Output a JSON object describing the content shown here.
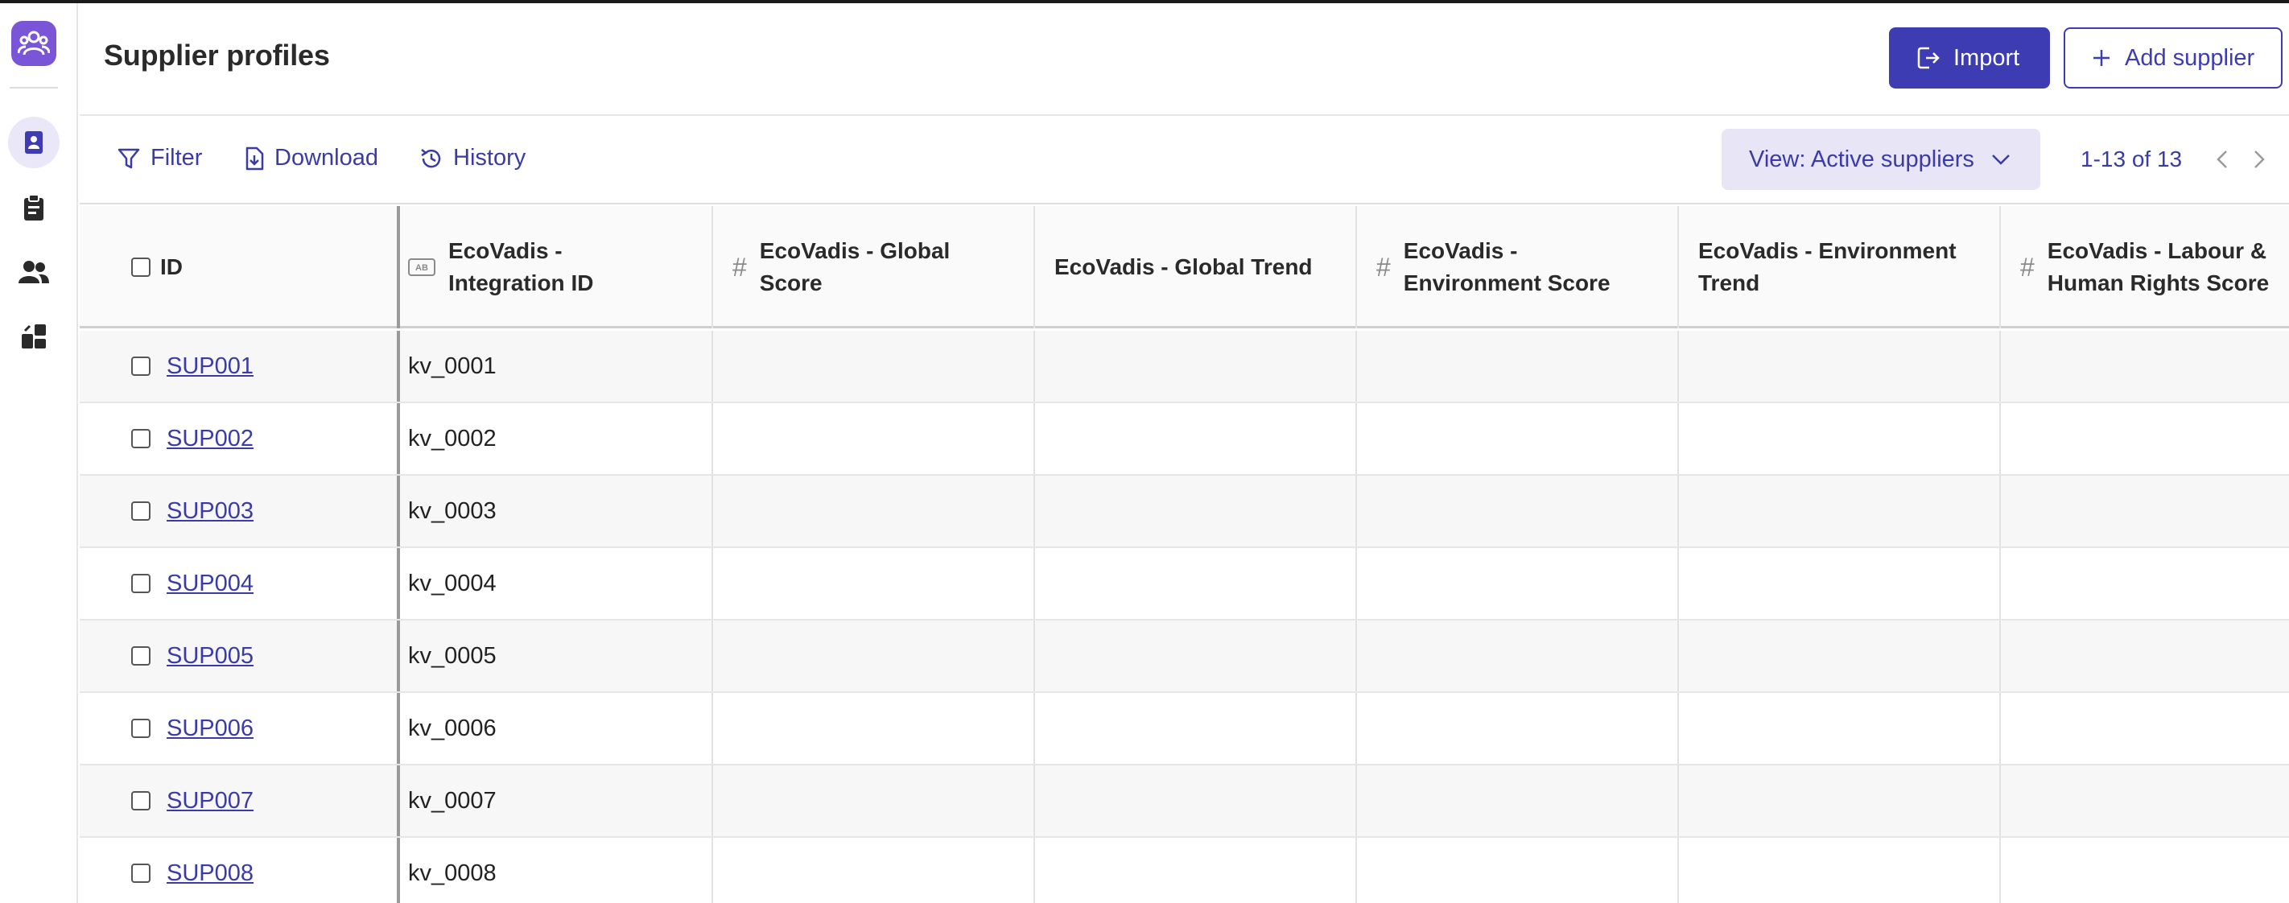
{
  "sidebar": {
    "logo": "team-logo-icon",
    "items": [
      {
        "name": "profiles-icon",
        "active": true
      },
      {
        "name": "clipboard-icon",
        "active": false
      },
      {
        "name": "users-icon",
        "active": false
      },
      {
        "name": "integrations-icon",
        "active": false
      }
    ]
  },
  "header": {
    "title": "Supplier profiles",
    "import_label": "Import",
    "add_label": "Add supplier"
  },
  "toolbar": {
    "filter_label": "Filter",
    "download_label": "Download",
    "history_label": "History",
    "view_label": "View: Active suppliers",
    "pagination": "1-13 of 13"
  },
  "table": {
    "columns": [
      {
        "type_icon": "",
        "label_1": "ID",
        "label_2": ""
      },
      {
        "type_icon": "AB",
        "label_1": "EcoVadis -",
        "label_2": "Integration ID"
      },
      {
        "type_icon": "#",
        "label_1": "EcoVadis - Global",
        "label_2": "Score"
      },
      {
        "type_icon": "",
        "label_1": "EcoVadis - Global Trend",
        "label_2": ""
      },
      {
        "type_icon": "#",
        "label_1": "EcoVadis -",
        "label_2": "Environment Score"
      },
      {
        "type_icon": "",
        "label_1": "EcoVadis - Environment",
        "label_2": "Trend"
      },
      {
        "type_icon": "#",
        "label_1": "EcoVadis - Labour &",
        "label_2": "Human Rights Score"
      }
    ],
    "rows": [
      {
        "id": "SUP001",
        "integration_id": "kv_0001"
      },
      {
        "id": "SUP002",
        "integration_id": "kv_0002"
      },
      {
        "id": "SUP003",
        "integration_id": "kv_0003"
      },
      {
        "id": "SUP004",
        "integration_id": "kv_0004"
      },
      {
        "id": "SUP005",
        "integration_id": "kv_0005"
      },
      {
        "id": "SUP006",
        "integration_id": "kv_0006"
      },
      {
        "id": "SUP007",
        "integration_id": "kv_0007"
      },
      {
        "id": "SUP008",
        "integration_id": "kv_0008"
      }
    ]
  },
  "colors": {
    "brand": "#3d3cb2",
    "logo": "#7b55d8",
    "active_bg": "#e9e7f8"
  }
}
